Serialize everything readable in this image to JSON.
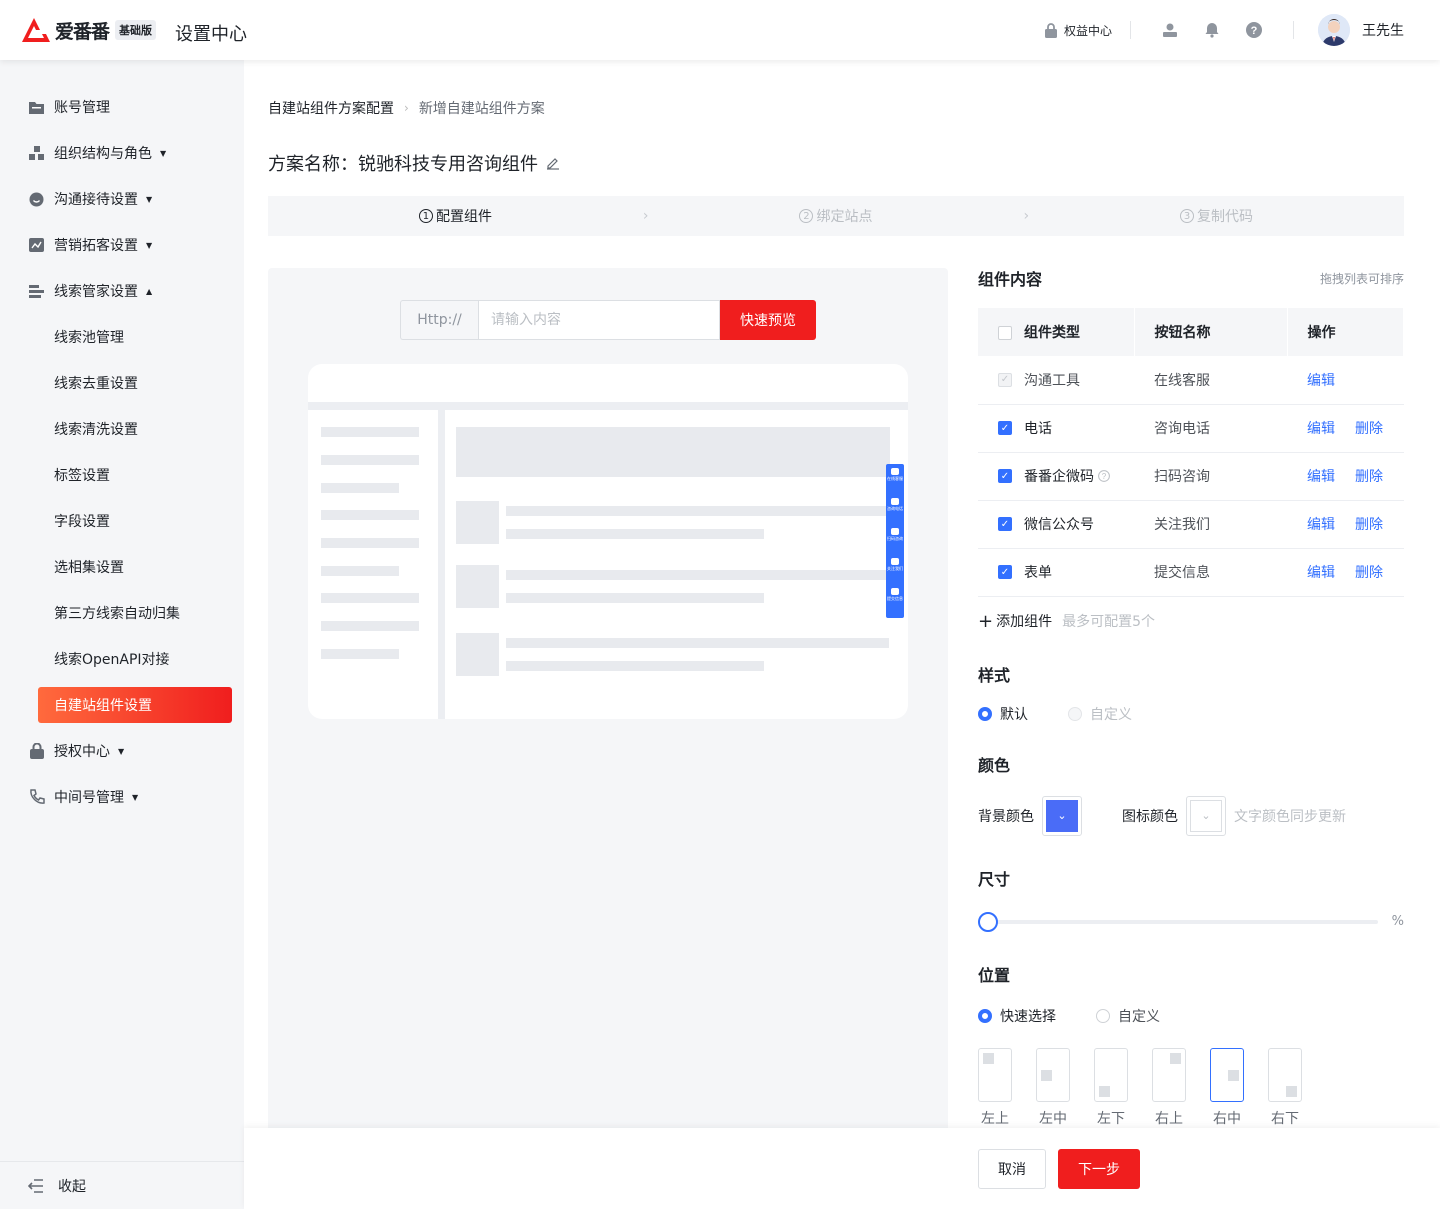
{
  "header": {
    "logo_text": "爱番番",
    "edition": "基础版",
    "app_title": "设置中心",
    "rights_label": "权益中心",
    "user_name": "王先生",
    "icons": [
      "lock-icon",
      "user-icon",
      "bell-icon",
      "help-icon"
    ]
  },
  "sidebar": {
    "items": [
      {
        "label": "账号管理",
        "icon": "folder-icon"
      },
      {
        "label": "组织结构与角色",
        "icon": "org-icon"
      },
      {
        "label": "沟通接待设置",
        "icon": "chat-icon"
      },
      {
        "label": "营销拓客设置",
        "icon": "chart-icon"
      },
      {
        "label": "线索管家设置",
        "icon": "bars-icon"
      },
      {
        "label": "授权中心",
        "icon": "lock-icon"
      },
      {
        "label": "中间号管理",
        "icon": "phone-icon"
      }
    ],
    "subitems": [
      "线索池管理",
      "线索去重设置",
      "线索清洗设置",
      "标签设置",
      "字段设置",
      "选相集设置",
      "第三方线索自动归集",
      "线索OpenAPI对接",
      "自建站组件设置"
    ],
    "collapse_label": "收起"
  },
  "breadcrumb": {
    "parent": "自建站组件方案配置",
    "current": "新增自建站组件方案"
  },
  "plan": {
    "label": "方案名称：",
    "name": "锐驰科技专用咨询组件"
  },
  "steps": [
    {
      "num": "1",
      "label": "配置组件",
      "state": "active"
    },
    {
      "num": "2",
      "label": "绑定站点",
      "state": "pending"
    },
    {
      "num": "3",
      "label": "复制代码",
      "state": "pending"
    }
  ],
  "preview": {
    "url_prefix": "Http://",
    "url_placeholder": "请输入内容",
    "preview_button": "快速预览",
    "float_items": [
      "在线客服",
      "咨询电话",
      "扫码咨询",
      "关注我们",
      "提交信息"
    ]
  },
  "components": {
    "title": "组件内容",
    "hint": "拖拽列表可排序",
    "columns": [
      "组件类型",
      "按钮名称",
      "操作"
    ],
    "rows": [
      {
        "type": "沟通工具",
        "name": "在线客服",
        "edit": "编辑",
        "delete": "",
        "checked": "disabled"
      },
      {
        "type": "电话",
        "name": "咨询电话",
        "edit": "编辑",
        "delete": "删除",
        "checked": "on"
      },
      {
        "type": "番番企微码",
        "name": "扫码咨询",
        "edit": "编辑",
        "delete": "删除",
        "checked": "on"
      },
      {
        "type": "微信公众号",
        "name": "关注我们",
        "edit": "编辑",
        "delete": "删除",
        "checked": "on"
      },
      {
        "type": "表单",
        "name": "提交信息",
        "edit": "编辑",
        "delete": "删除",
        "checked": "on"
      }
    ],
    "add_label": "添加组件",
    "add_limit": "最多可配置5个"
  },
  "style": {
    "title": "样式",
    "default_label": "默认",
    "custom_label": "自定义",
    "selected": "默认"
  },
  "color": {
    "title": "颜色",
    "bg_label": "背景颜色",
    "bg_color": "#4a6cf7",
    "icon_label": "图标颜色",
    "icon_color": "#ffffff",
    "sync_hint": "文字颜色同步更新"
  },
  "size": {
    "title": "尺寸",
    "unit": "%",
    "value": 0
  },
  "position": {
    "title": "位置",
    "quick_label": "快速选择",
    "custom_label": "自定义",
    "options": [
      "左上",
      "左中",
      "左下",
      "右上",
      "右中",
      "右下"
    ],
    "selected": "右中"
  },
  "footer": {
    "cancel": "取消",
    "next": "下一步"
  },
  "colors": {
    "accent": "#f01e1e",
    "primary": "#3370ff"
  }
}
